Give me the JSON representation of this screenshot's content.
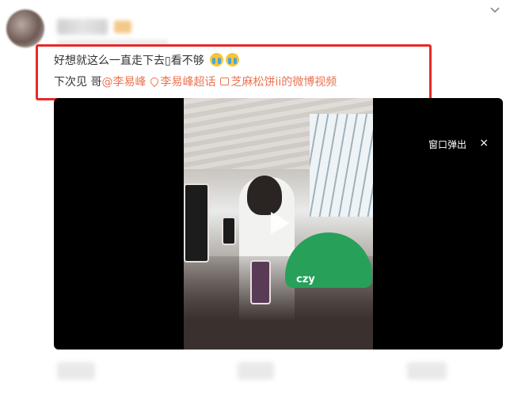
{
  "post": {
    "text_line1": "好想就这么一直走下去",
    "text_line1_tail": "看不够",
    "text_line2_prefix": "下次见 哥",
    "mention": "@李易峰",
    "topic": "李易峰超话",
    "video_link": "芝麻松饼ii的微博视频"
  },
  "video": {
    "popout_label": "窗口弹出",
    "close_symbol": "×",
    "overlay_text": "czy"
  },
  "colors": {
    "link": "#eb7350",
    "highlight_border": "#e62a28",
    "video_bg": "#000000",
    "cap": "#27a05a"
  },
  "icons": [
    "more-chevron-icon",
    "crying-emoji-icon",
    "topic-icon",
    "video-link-icon",
    "play-icon",
    "close-icon"
  ]
}
